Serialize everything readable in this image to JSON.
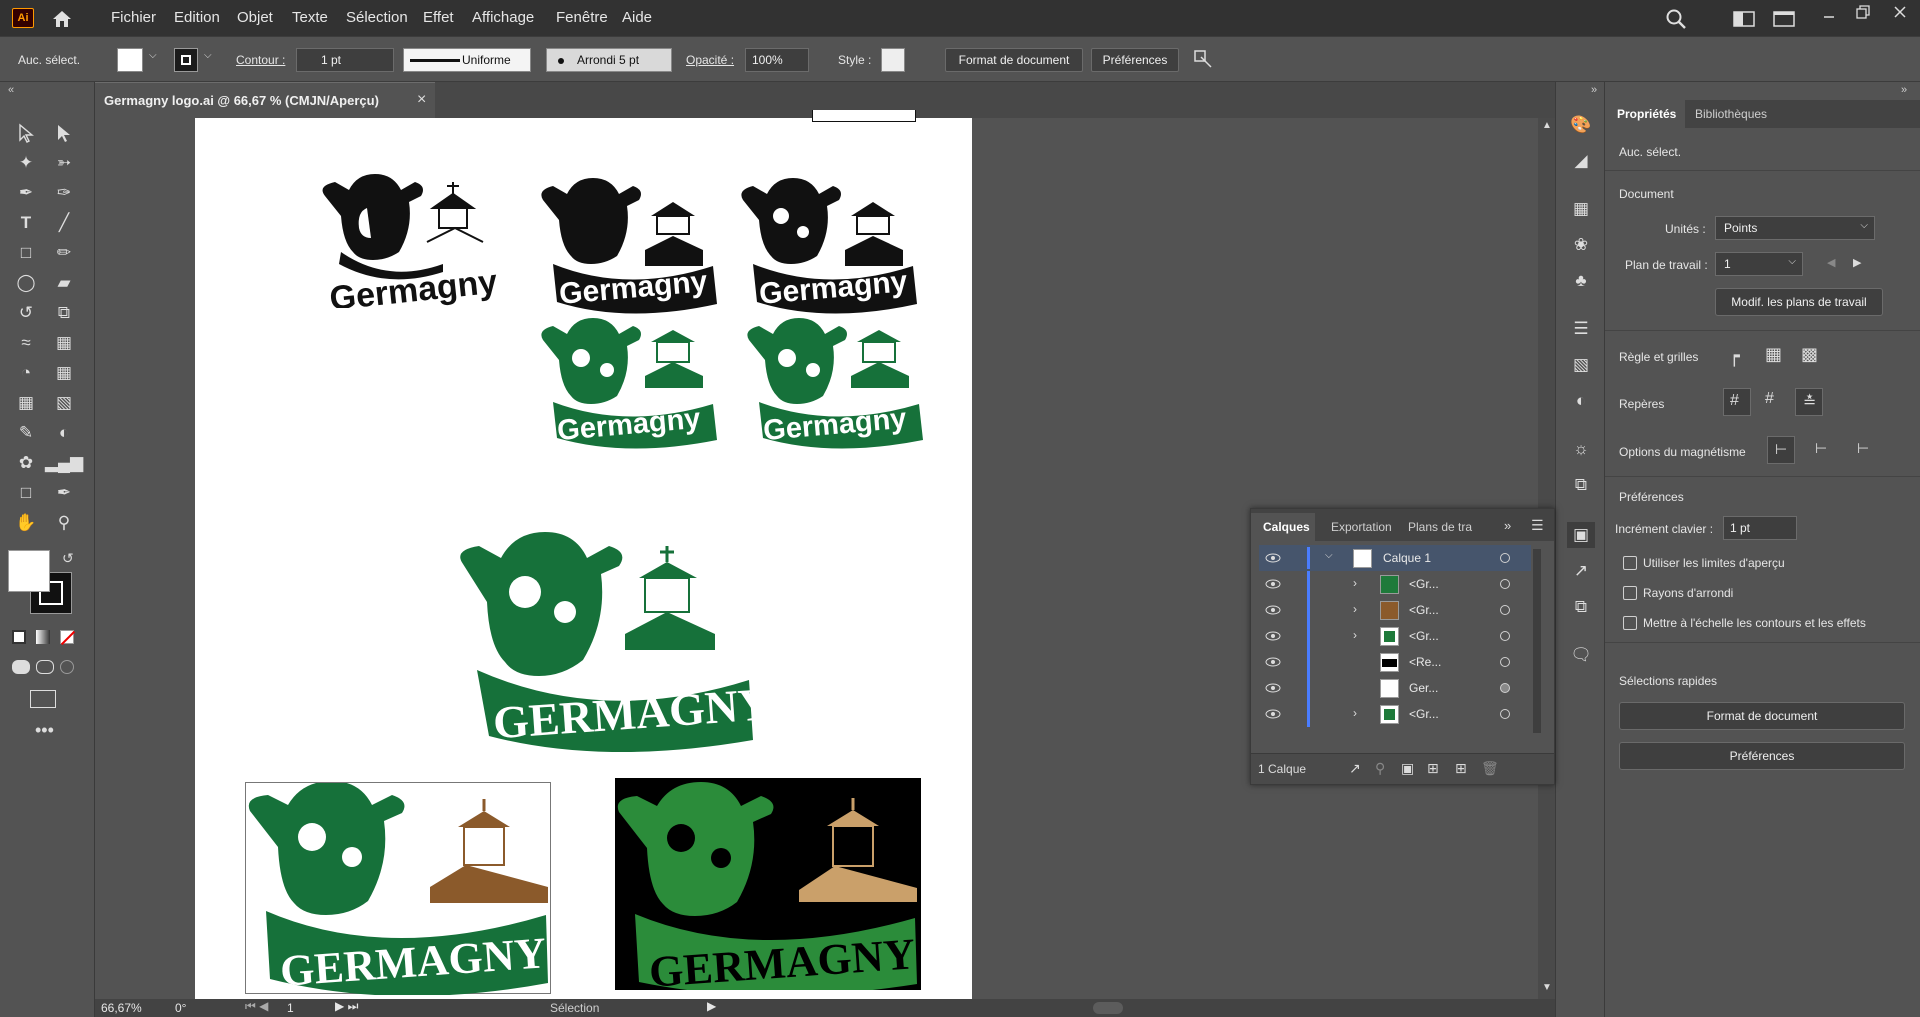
{
  "app": {
    "logo": "Ai",
    "accent": "#ff9a00"
  },
  "menu": [
    "Fichier",
    "Edition",
    "Objet",
    "Texte",
    "Sélection",
    "Effet",
    "Affichage",
    "Fenêtre",
    "Aide"
  ],
  "control": {
    "selection": "Auc. sélect.",
    "contour_label": "Contour :",
    "stroke_weight": "1 pt",
    "profile": "Uniforme",
    "brush": "Arrondi 5 pt",
    "opacity_label": "Opacité :",
    "opacity": "100%",
    "style_label": "Style :",
    "doc_setup": "Format de document",
    "prefs": "Préférences"
  },
  "document": {
    "tab_title": "Germagny logo.ai @ 66,67 % (CMJN/Aperçu)",
    "close": "×"
  },
  "artwork": {
    "logo_text": "Germagny",
    "logo_text_caps": "GERMAGNY",
    "green": "#16713a",
    "brown": "#8b5a2b",
    "tan": "#caa06a"
  },
  "status": {
    "zoom": "66,67%",
    "rotation": "0°",
    "artboard": "1",
    "mode": "Sélection"
  },
  "properties": {
    "tabs": [
      "Propriétés",
      "Bibliothèques"
    ],
    "selection": "Auc. sélect.",
    "document_title": "Document",
    "units_label": "Unités :",
    "units_value": "Points",
    "artboard_label": "Plan de travail :",
    "artboard_value": "1",
    "edit_artboards": "Modif. les plans de travail",
    "rulers_grids": "Règle et grilles",
    "guides": "Repères",
    "snap_options": "Options du magnétisme",
    "preferences_title": "Préférences",
    "keyboard_increment_label": "Incrément clavier :",
    "keyboard_increment_value": "1 pt",
    "check_preview_bounds": "Utiliser les limites d'aperçu",
    "check_round_corners": "Rayons d'arrondi",
    "check_scale_strokes": "Mettre à l'échelle les contours et les effets",
    "quick_actions": "Sélections rapides",
    "doc_setup": "Format de document",
    "prefs": "Préférences"
  },
  "layers": {
    "tabs": [
      "Calques",
      "Exportation",
      "Plans de tra"
    ],
    "rows": [
      "Calque 1",
      "<Gr...",
      "<Gr...",
      "<Gr...",
      "<Re...",
      "Ger...",
      "<Gr..."
    ],
    "footer": "1 Calque"
  }
}
